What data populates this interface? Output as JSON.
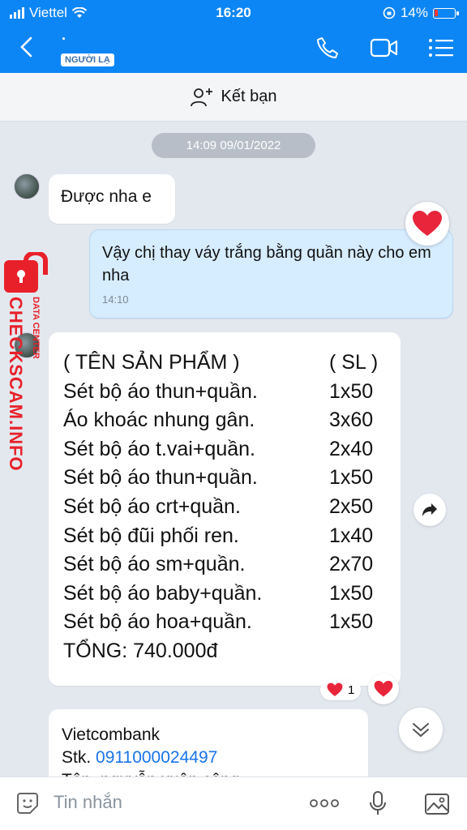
{
  "status_bar": {
    "carrier": "Viettel",
    "time": "16:20",
    "battery": "14%"
  },
  "header": {
    "contact_name": "·",
    "stranger_badge": "NGƯỜI LẠ"
  },
  "add_friend": {
    "label": "Kết bạn"
  },
  "chat": {
    "timestamp": "14:09 09/01/2022",
    "msg1": "Được nha e",
    "msg2": {
      "text": "Vậy chị thay váy trắng bằng quần này cho em nha",
      "time": "14:10"
    },
    "product_list": {
      "header": {
        "name": "( TÊN SẢN PHẨM )",
        "qty": "( SL )"
      },
      "items": [
        {
          "name": "Sét bộ áo thun+quần.",
          "qty": "1x50"
        },
        {
          "name": "Áo khoác nhung gân.",
          "qty": "3x60"
        },
        {
          "name": "Sét bộ áo t.vai+quần.",
          "qty": "2x40"
        },
        {
          "name": "Sét bộ áo thun+quần.",
          "qty": "1x50"
        },
        {
          "name": "Sét bộ áo crt+quần.",
          "qty": "2x50"
        },
        {
          "name": "Sét bộ đũi phối ren.",
          "qty": "1x40"
        },
        {
          "name": "Sét bộ áo sm+quần.",
          "qty": "2x70"
        },
        {
          "name": "Sét bộ áo baby+quần.",
          "qty": "1x50"
        },
        {
          "name": "Sét bộ áo hoa+quần.",
          "qty": "1x50"
        }
      ],
      "total": "TỔNG: 740.000đ"
    },
    "reaction_count": "1",
    "bank_msg": {
      "bank": "Vietcombank",
      "stk_label": "Stk.",
      "stk": "0911000024497",
      "name_partial": "Tên. nguyễn xuân công"
    }
  },
  "watermark": {
    "main": "CHECKSCAM.INFO",
    "sub": "DATA CENTER"
  },
  "input": {
    "placeholder": "Tin nhắn"
  },
  "colors": {
    "header": "#0d86f5",
    "chat_bg": "#e3e8ef",
    "my_bubble": "#d6ecff",
    "watermark": "#e8202a"
  }
}
